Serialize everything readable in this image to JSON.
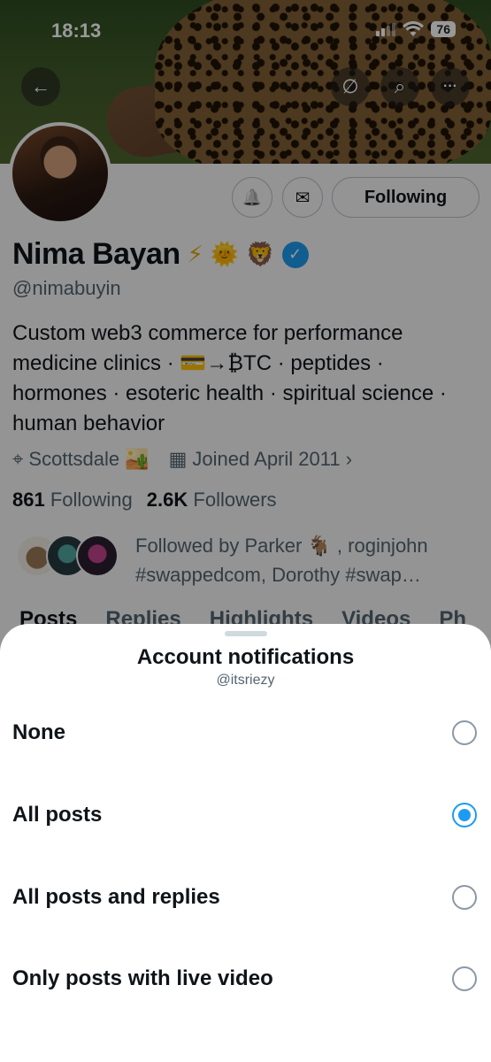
{
  "status": {
    "time": "18:13",
    "battery": "76"
  },
  "nav": {
    "back_icon": "arrow-left-icon",
    "back_glyph": "←",
    "mute_glyph": "∅",
    "search_glyph": "⌕",
    "more_glyph": "···"
  },
  "profile": {
    "name": "Nima Bayan",
    "name_emojis": [
      "⚡",
      "🌞",
      "🦁"
    ],
    "verified_glyph": "✓",
    "handle": "@nimabuyin",
    "bio": "Custom web3 commerce for performance medicine clinics · 💳→₿TC · peptides · hormones · esoteric health · spiritual science · human behavior",
    "location": "Scottsdale 🏜️",
    "joined": "Joined April 2011 ›",
    "following_count": "861",
    "following_label": "Following",
    "followers_count": "2.6K",
    "followers_label": "Followers",
    "followed_by": "Followed by Parker 🐐 , roginjohn #swappedcom, Dorothy #swap…",
    "following_button": "Following",
    "bell_glyph": "🔔",
    "mail_glyph": "✉",
    "location_glyph": "⌖",
    "calendar_glyph": "▦"
  },
  "tabs": [
    "Posts",
    "Replies",
    "Highlights",
    "Videos",
    "Ph"
  ],
  "sheet": {
    "title": "Account notifications",
    "subtitle": "@itsriezy",
    "options": [
      {
        "label": "None",
        "selected": false
      },
      {
        "label": "All posts",
        "selected": true
      },
      {
        "label": "All posts and replies",
        "selected": false
      },
      {
        "label": "Only posts with live video",
        "selected": false
      }
    ]
  },
  "colors": {
    "accent": "#1d9bf0",
    "text": "#0f1419",
    "muted": "#536471"
  }
}
